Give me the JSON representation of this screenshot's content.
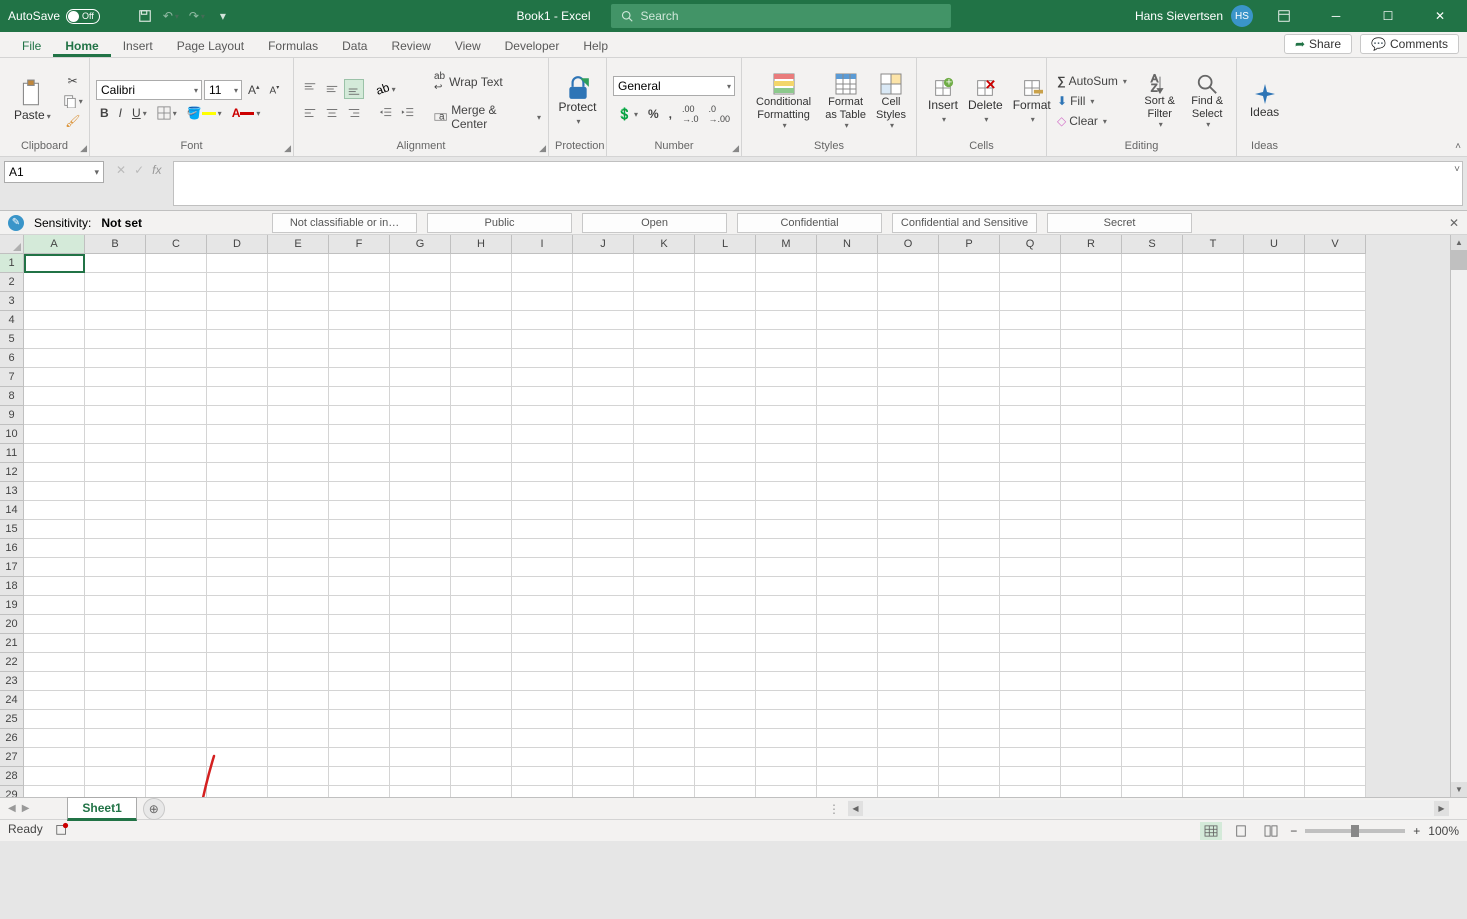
{
  "titlebar": {
    "autosave_label": "AutoSave",
    "autosave_state": "Off",
    "doc_title": "Book1  -  Excel",
    "search_placeholder": "Search",
    "user_name": "Hans Sievertsen",
    "user_initials": "HS"
  },
  "tabs": {
    "items": [
      "File",
      "Home",
      "Insert",
      "Page Layout",
      "Formulas",
      "Data",
      "Review",
      "View",
      "Developer",
      "Help"
    ],
    "active": "Home",
    "share": "Share",
    "comments": "Comments"
  },
  "ribbon": {
    "clipboard": {
      "label": "Clipboard",
      "paste": "Paste"
    },
    "font": {
      "label": "Font",
      "name": "Calibri",
      "size": "11"
    },
    "alignment": {
      "label": "Alignment",
      "wrap": "Wrap Text",
      "merge": "Merge & Center"
    },
    "protection": {
      "label": "Protection",
      "protect": "Protect"
    },
    "number": {
      "label": "Number",
      "format": "General"
    },
    "styles": {
      "label": "Styles",
      "cond": "Conditional Formatting",
      "table": "Format as Table",
      "cell": "Cell Styles"
    },
    "cells": {
      "label": "Cells",
      "insert": "Insert",
      "delete": "Delete",
      "format": "Format"
    },
    "editing": {
      "label": "Editing",
      "autosum": "AutoSum",
      "fill": "Fill",
      "clear": "Clear",
      "sort": "Sort & Filter",
      "find": "Find & Select"
    },
    "ideas": {
      "label": "Ideas",
      "ideas": "Ideas"
    }
  },
  "namebox": {
    "value": "A1"
  },
  "sensitivity": {
    "label": "Sensitivity:",
    "value": "Not set",
    "options": [
      "Not classifiable or in…",
      "Public",
      "Open",
      "Confidential",
      "Confidential and Sensitive",
      "Secret"
    ]
  },
  "columns": [
    "A",
    "B",
    "C",
    "D",
    "E",
    "F",
    "G",
    "H",
    "I",
    "J",
    "K",
    "L",
    "M",
    "N",
    "O",
    "P",
    "Q",
    "R",
    "S",
    "T",
    "U",
    "V"
  ],
  "row_count": 29,
  "sheets": {
    "active": "Sheet1"
  },
  "status": {
    "ready": "Ready",
    "zoom": "100%"
  }
}
